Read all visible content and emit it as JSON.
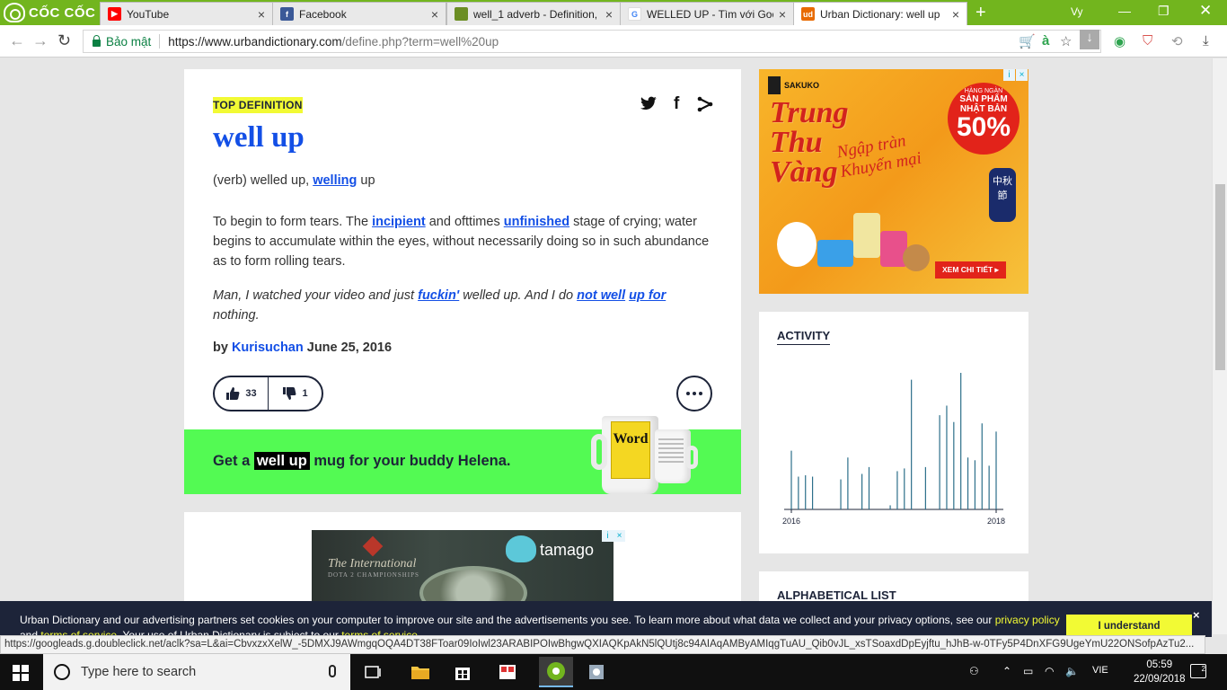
{
  "browser": {
    "brand": "CỐC CỐC",
    "tabs": [
      {
        "label": "YouTube",
        "icon": "youtube-icon",
        "color": "#ff0000"
      },
      {
        "label": "Facebook",
        "icon": "facebook-icon",
        "color": "#3b5998"
      },
      {
        "label": "well_1 adverb - Definition,",
        "icon": "oxford-icon",
        "color": "#6b8e23"
      },
      {
        "label": "WELLED UP - Tìm với Goog",
        "icon": "google-icon",
        "color": "#4285f4"
      },
      {
        "label": "Urban Dictionary: well up",
        "icon": "urban-dictionary-icon",
        "color": "#e86a00",
        "fav_text": "ud"
      }
    ],
    "profile": "Vy",
    "secure_label": "Bảo mật",
    "url_host": "https://www.urbandictionary.com",
    "url_path": "/define.php?term=well%20up"
  },
  "definition": {
    "label": "TOP DEFINITION",
    "word": "well up",
    "verb_prefix": "(verb) welled up,",
    "verb_link": "welling",
    "verb_suffix": "up",
    "meaning_1": "To begin to form tears. The",
    "meaning_link_1": "incipient",
    "meaning_2": "and ofttimes",
    "meaning_link_2": "unfinished",
    "meaning_3": "stage of crying; water begins to accumulate within the eyes, without necessarily doing so in such abundance as to form rolling tears.",
    "example_1": "Man, I watched your video and just",
    "example_link_1": "fuckin'",
    "example_2": "welled up. And I do",
    "example_link_2": "not well",
    "example_link_3": "up for",
    "example_3": "nothing.",
    "by_label": "by",
    "author": "Kurisuchan",
    "date": "June 25, 2016",
    "upvotes": "33",
    "downvotes": "1"
  },
  "mug": {
    "prefix": "Get a",
    "highlight": "well up",
    "suffix": "mug for your buddy Helena.",
    "mug_word": "Word"
  },
  "ads": {
    "dota_title": "The International",
    "dota_sub": "DOTA 2 CHAMPIONSHIPS",
    "tamago": "tamago",
    "sakuko": "SAKUKO",
    "trung_thu": "Trung Thu Vàng",
    "ngap_tran": "Ngập tràn Khuyến mại",
    "badge_small": "HÀNG NGÀN",
    "badge_mid": "SẢN PHẨM NHẬT BẢN",
    "badge_pct": "50%",
    "lantern": "中秋節",
    "cta": "XEM CHI TIẾT ▸"
  },
  "activity": {
    "title": "ACTIVITY",
    "start_year": "2016",
    "end_year": "2018"
  },
  "chart_data": {
    "type": "bar",
    "title": "ACTIVITY",
    "xlabel": "",
    "ylabel": "",
    "x_range": [
      "2016",
      "2018"
    ],
    "values": [
      0.43,
      0.24,
      0.25,
      0.24,
      0,
      0,
      0,
      0.22,
      0.38,
      0,
      0.26,
      0.31,
      0,
      0,
      0.03,
      0.28,
      0.3,
      0.95,
      0,
      0.31,
      0,
      0.69,
      0.76,
      0.64,
      1.0,
      0.38,
      0.36,
      0.63,
      0.32,
      0.57
    ],
    "grid": false
  },
  "sidebar": {
    "alpha_title": "ALPHABETICAL LIST"
  },
  "cookie": {
    "text": "Urban Dictionary and our advertising partners set cookies on your computer to improve our site and the advertisements you see. To learn more about what data we collect and your privacy options, see our",
    "link": "privacy policy",
    "text2": "and",
    "link2": "terms of service",
    "text3": ". Your use of Urban Dictionary is subject to our",
    "link3": "terms of service",
    "button": "I understand",
    "close": "×"
  },
  "status_url": "https://googleads.g.doubleclick.net/aclk?sa=L&ai=CbvxzxXelW_-5DMXJ9AWmgqOQA4DT38FToar09IoIwl23ARABIPOIwBhgwQXIAQKpAkN5lQUtj8c94AIAqAMByAMIqgTuAU_Qib0vJL_xsTSoaxdDpEyjftu_hJhB-w-0TFy5P4DnXFG9UgeYmU22ONSofpAzTu2...",
  "taskbar": {
    "search_placeholder": "Type here to search",
    "lang": "VIE",
    "time": "05:59",
    "date": "22/09/2018",
    "notif_count": "2"
  }
}
